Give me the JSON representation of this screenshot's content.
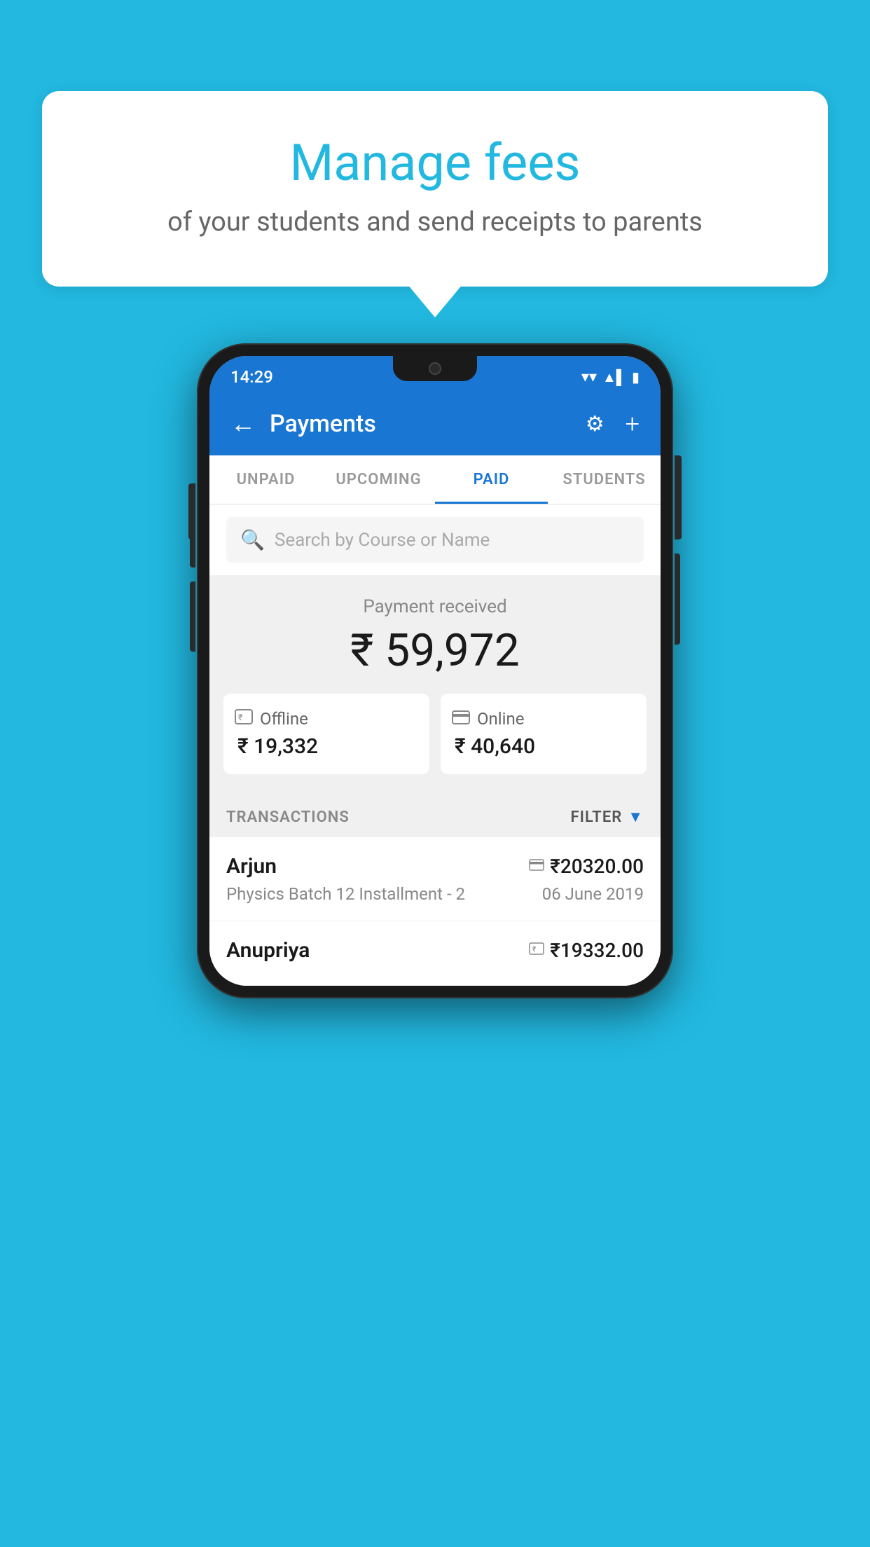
{
  "background_color": "#22b8e0",
  "speech_bubble": {
    "title": "Manage fees",
    "subtitle": "of your students and send receipts to parents"
  },
  "status_bar": {
    "time": "14:29",
    "wifi": "▼",
    "signal": "▲",
    "battery": "▮"
  },
  "header": {
    "back_label": "←",
    "title": "Payments",
    "settings_label": "⚙",
    "plus_label": "+"
  },
  "tabs": [
    {
      "label": "UNPAID",
      "active": false
    },
    {
      "label": "UPCOMING",
      "active": false
    },
    {
      "label": "PAID",
      "active": true
    },
    {
      "label": "STUDENTS",
      "active": false
    }
  ],
  "search": {
    "placeholder": "Search by Course or Name"
  },
  "payment_summary": {
    "label": "Payment received",
    "total": "₹ 59,972",
    "offline": {
      "icon": "offline-icon",
      "label": "Offline",
      "amount": "₹ 19,332"
    },
    "online": {
      "icon": "online-icon",
      "label": "Online",
      "amount": "₹ 40,640"
    }
  },
  "transactions": {
    "header_label": "TRANSACTIONS",
    "filter_label": "FILTER",
    "rows": [
      {
        "name": "Arjun",
        "amount": "₹20320.00",
        "course": "Physics Batch 12 Installment - 2",
        "date": "06 June 2019",
        "payment_type": "online"
      },
      {
        "name": "Anupriya",
        "amount": "₹19332.00",
        "course": "",
        "date": "",
        "payment_type": "offline"
      }
    ]
  }
}
